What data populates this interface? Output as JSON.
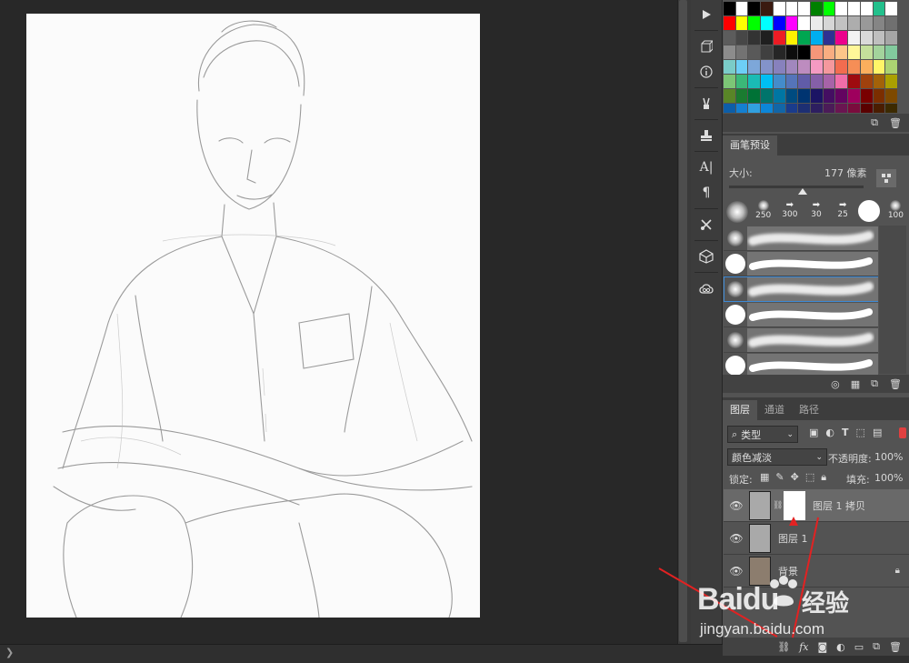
{
  "panels": {
    "brush_preset": {
      "tab_label": "画笔预设",
      "size_label": "大小:",
      "size_value": "177 像素",
      "size_slider_fraction": 0.55,
      "tip_sizes": [
        "250",
        "300",
        "30",
        "25",
        "",
        "100"
      ]
    },
    "layers": {
      "tabs": [
        "图层",
        "通道",
        "路径"
      ],
      "filter_kind": "类型",
      "blend_mode": "颜色减淡",
      "opacity_label": "不透明度:",
      "opacity_value": "100%",
      "lock_label": "锁定:",
      "fill_label": "填充:",
      "fill_value": "100%",
      "layer_items": [
        {
          "name": "图层 1 拷贝"
        },
        {
          "name": "图层 1"
        },
        {
          "name": "背景"
        }
      ]
    }
  },
  "watermark": {
    "brand": "Baidu",
    "cn": "经验",
    "url": "jingyan.baidu.com"
  },
  "colors": {
    "swatch_rows": [
      [
        "#000000",
        "#ffffff",
        "#000000",
        "#3a1a10",
        "#ffffff",
        "#ffffff",
        "#ffffff",
        "#008000",
        "#00ff00",
        "#ffffff",
        "#ffffff",
        "#ffffff",
        "#23c08c",
        "#ffffff"
      ],
      [
        "#ff0000",
        "#ffff00",
        "#00ff00",
        "#00ffff",
        "#0000ff",
        "#ff00ff",
        "#ffffff",
        "#ebebeb",
        "#d6d6d6",
        "#c2c2c2",
        "#adadad",
        "#999999",
        "#858585",
        "#707070"
      ],
      [
        "#5c5c5c",
        "#474747",
        "#333333",
        "#1f1f1f",
        "#ed1c24",
        "#fff200",
        "#00a651",
        "#00aeef",
        "#2e3192",
        "#ec008c",
        "#f2f2f2",
        "#d9d9d9",
        "#bfbfbf",
        "#a6a6a6"
      ],
      [
        "#8c8c8c",
        "#737373",
        "#595959",
        "#404040",
        "#262626",
        "#0d0d0d",
        "#000000",
        "#f69679",
        "#f9ad81",
        "#fdc689",
        "#fff799",
        "#c4df9b",
        "#a3d39c",
        "#82ca9d"
      ],
      [
        "#7accc8",
        "#6dcff6",
        "#7da7d9",
        "#8393ca",
        "#8781bd",
        "#a187be",
        "#bd8cbf",
        "#f49ac2",
        "#f5989d",
        "#f26c4f",
        "#f68e56",
        "#fbaf5d",
        "#fff568",
        "#acd372"
      ],
      [
        "#7cc576",
        "#3bb878",
        "#1abbb4",
        "#00bff3",
        "#448ccb",
        "#5574b9",
        "#605ca8",
        "#855fa8",
        "#a763a8",
        "#f06ea9",
        "#9e0b0f",
        "#a0410d",
        "#a36209",
        "#aba000"
      ],
      [
        "#598527",
        "#1a7b30",
        "#007236",
        "#00746b",
        "#0076a3",
        "#004b80",
        "#003471",
        "#1b1464",
        "#440e62",
        "#630460",
        "#9e005d",
        "#790000",
        "#7b2e00",
        "#7d4900"
      ],
      [
        "#0d5ea8",
        "#1480d1",
        "#31a0e0",
        "#0c86d8",
        "#1266a7",
        "#1a3c8c",
        "#1d2f73",
        "#2d1e60",
        "#4b1b58",
        "#6a1551",
        "#7a0c3d",
        "#5a0000",
        "#4a1d00",
        "#3c2a00"
      ]
    ],
    "accent_red": "#e22222",
    "selection_blue": "#3d8ad6"
  },
  "icons": {
    "play": "play-icon",
    "cube_info": "3d-info-icon",
    "info": "info-icon",
    "brush": "brush-icon",
    "stamp": "clone-source-icon",
    "type": "character-icon",
    "paragraph": "paragraph-icon",
    "tools": "tool-presets-icon",
    "box3d": "3d-icon",
    "cloud": "creative-cloud-icon"
  }
}
